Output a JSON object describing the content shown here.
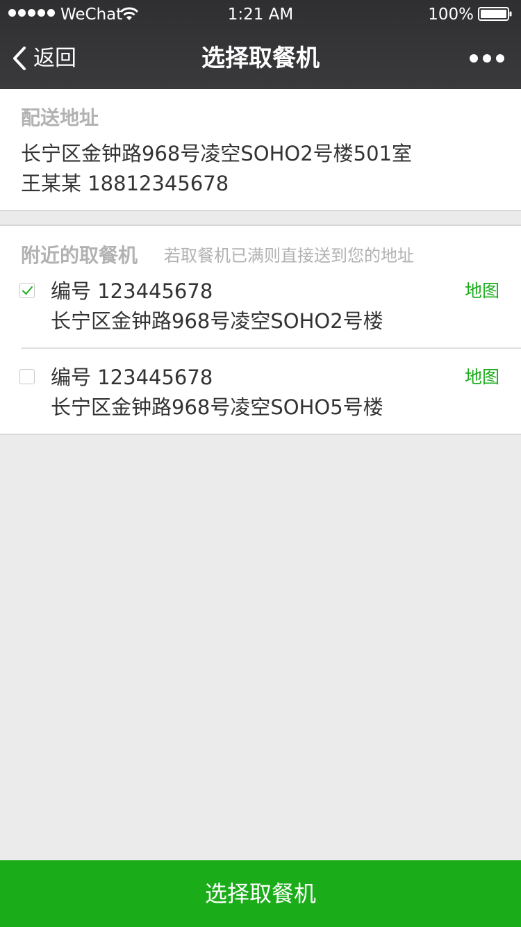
{
  "status_bar": {
    "carrier": "WeChat",
    "time": "1:21 AM",
    "battery": "100%",
    "signal_icon": "signal-dots-icon",
    "wifi_icon": "wifi-icon",
    "battery_icon": "battery-icon"
  },
  "nav": {
    "back_label": "返回",
    "title": "选择取餐机",
    "back_icon": "chevron-left-icon",
    "more_icon": "more-dots-icon"
  },
  "address": {
    "title": "配送地址",
    "line1": "长宁区金钟路968号凌空SOHO2号楼501室",
    "line2": "王某某 18812345678"
  },
  "nearby": {
    "title": "附近的取餐机",
    "hint": "若取餐机已满则直接送到您的地址",
    "machines": [
      {
        "id_text": "编号 123445678",
        "address": "长宁区金钟路968号凌空SOHO2号楼",
        "map_label": "地图",
        "checked": true
      },
      {
        "id_text": "编号 123445678",
        "address": "长宁区金钟路968号凌空SOHO5号楼",
        "map_label": "地图",
        "checked": false
      }
    ]
  },
  "confirm_button": "选择取餐机",
  "colors": {
    "accent": "#1aad19",
    "header_bg": "#353537",
    "page_bg": "#ebebeb",
    "muted_text": "#b2b2b2",
    "body_text": "#333333"
  }
}
